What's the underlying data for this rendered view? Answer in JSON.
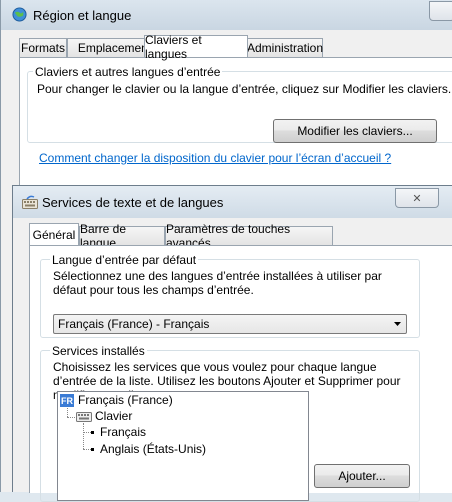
{
  "region_window": {
    "title": "Région et langue",
    "tabs": [
      {
        "label": "Formats"
      },
      {
        "label": "Emplacement"
      },
      {
        "label": "Claviers et langues"
      },
      {
        "label": "Administration"
      }
    ],
    "group_title": "Claviers et autres langues d’entrée",
    "group_desc": "Pour changer le clavier ou la langue d’entrée, cliquez sur Modifier les claviers.",
    "modify_button": "Modifier les claviers...",
    "help_link": "Comment changer la disposition du clavier pour l’écran d’accueil ?"
  },
  "services_window": {
    "title": "Services de texte et de langues",
    "close_glyph": "✕",
    "tabs": [
      {
        "label": "Général"
      },
      {
        "label": "Barre de langue"
      },
      {
        "label": "Paramètres de touches avancés"
      }
    ],
    "default_lang": {
      "title": "Langue d’entrée par défaut",
      "desc": "Sélectionnez une des langues d’entrée installées à utiliser par défaut pour tous les champs d’entrée.",
      "selected": "Français (France) - Français"
    },
    "installed": {
      "title": "Services installés",
      "desc": "Choisissez les services que vous voulez pour chaque langue d’entrée de la liste. Utilisez les boutons Ajouter et Supprimer pour modifier cette liste.",
      "tree": {
        "badge": "FR",
        "language": "Français (France)",
        "category": "Clavier",
        "items": [
          "Français",
          "Anglais (États-Unis)"
        ]
      },
      "add_button": "Ajouter..."
    }
  },
  "colors": {
    "link": "#0066cc",
    "badge": "#3a7bd5"
  }
}
